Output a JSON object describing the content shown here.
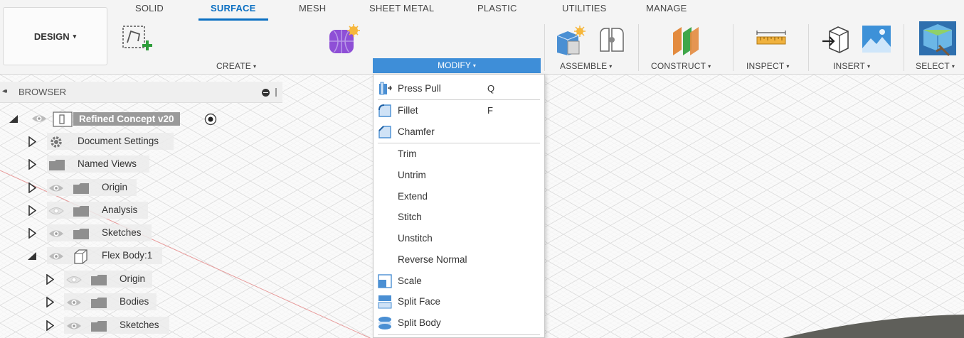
{
  "tabs": [
    {
      "label": "SOLID"
    },
    {
      "label": "SURFACE"
    },
    {
      "label": "MESH"
    },
    {
      "label": "SHEET METAL"
    },
    {
      "label": "PLASTIC"
    },
    {
      "label": "UTILITIES"
    },
    {
      "label": "MANAGE"
    }
  ],
  "active_tab": "SURFACE",
  "workspace": {
    "label": "DESIGN",
    "caret": "▾"
  },
  "groups": {
    "create": "CREATE",
    "modify": "MODIFY",
    "assemble": "ASSEMBLE",
    "construct": "CONSTRUCT",
    "inspect": "INSPECT",
    "insert": "INSERT",
    "select": "SELECT",
    "caret": "▾"
  },
  "modify_menu": [
    {
      "label": "Press Pull",
      "shortcut": "Q",
      "icon": "press-pull-icon"
    },
    {
      "label": "Fillet",
      "shortcut": "F",
      "icon": "fillet-icon"
    },
    {
      "label": "Chamfer",
      "shortcut": "",
      "icon": "chamfer-icon"
    },
    {
      "label": "Trim",
      "shortcut": ""
    },
    {
      "label": "Untrim",
      "shortcut": ""
    },
    {
      "label": "Extend",
      "shortcut": ""
    },
    {
      "label": "Stitch",
      "shortcut": ""
    },
    {
      "label": "Unstitch",
      "shortcut": ""
    },
    {
      "label": "Reverse Normal",
      "shortcut": ""
    },
    {
      "label": "Scale",
      "shortcut": "",
      "icon": "scale-icon"
    },
    {
      "label": "Split Face",
      "shortcut": "",
      "icon": "split-face-icon"
    },
    {
      "label": "Split Body",
      "shortcut": "",
      "icon": "split-body-icon"
    }
  ],
  "browser": {
    "title": "BROWSER",
    "root": {
      "label": "Refined Concept v20"
    },
    "items": [
      {
        "label": "Document Settings",
        "icon": "gear-icon",
        "expanded": false
      },
      {
        "label": "Named Views",
        "icon": "folder-icon",
        "expanded": false
      },
      {
        "label": "Origin",
        "icon": "folder-icon",
        "expanded": false
      },
      {
        "label": "Analysis",
        "icon": "folder-icon",
        "expanded": false
      },
      {
        "label": "Sketches",
        "icon": "folder-icon",
        "expanded": false
      },
      {
        "label": "Flex Body:1",
        "icon": "component-icon",
        "expanded": true
      },
      {
        "label": "Origin",
        "icon": "folder-icon",
        "expanded": false
      },
      {
        "label": "Bodies",
        "icon": "folder-icon",
        "expanded": false
      },
      {
        "label": "Sketches",
        "icon": "folder-icon",
        "expanded": false
      }
    ]
  },
  "colors": {
    "accent": "#0a6fc2",
    "modify_bar": "#3e8ed8",
    "toolbar_bg": "#f4f4f4",
    "root_label_bg": "#9a9a9a"
  }
}
